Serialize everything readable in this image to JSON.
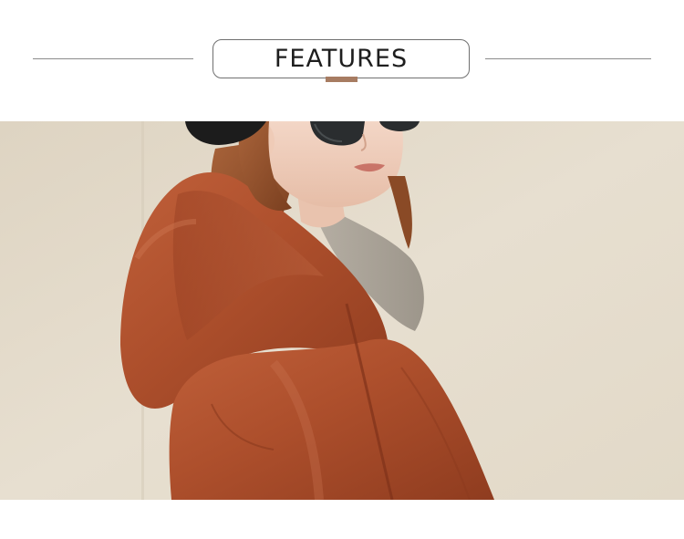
{
  "header": {
    "title": "FEATURES",
    "accent_color": "#a77c62",
    "rule_color": "#8c8c8c"
  },
  "photo": {
    "subject": "model-in-hooded-puffer-coat",
    "coat_color": "#b2522f",
    "wall_color": "#e5dccb"
  }
}
